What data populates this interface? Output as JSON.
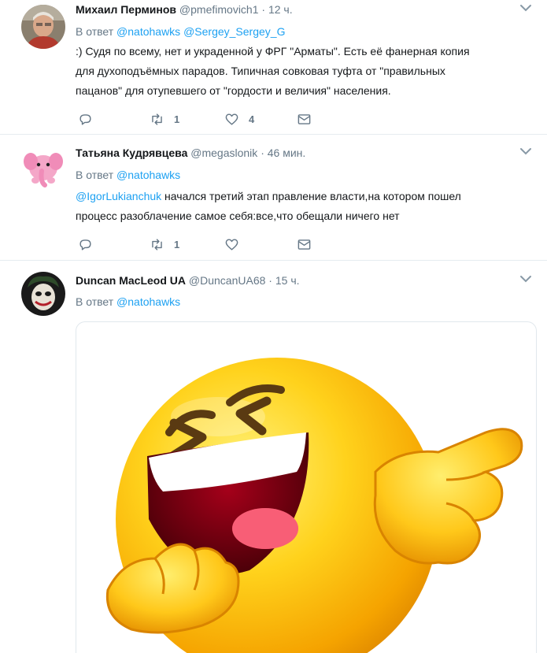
{
  "tweets": [
    {
      "name": "Михаил Перминов",
      "handle": "@pmefimovich1",
      "time": "12 ч.",
      "reply_prefix": "В ответ",
      "mentions": [
        "@natohawks",
        "@Sergey_Sergey_G"
      ],
      "text_lines": [
        ":) Судя по всему, нет и украденной у ФРГ \"Арматы\". Есть её фанерная копия",
        "для духоподъёмных парадов. Типичная совковая туфта от \"правильных",
        "пацанов\" для отупевшего от \"гордости и величия\" населения."
      ],
      "retweets": "1",
      "likes": "4"
    },
    {
      "name": "Татьяна Кудрявцева",
      "handle": "@megaslonik",
      "time": "46 мин.",
      "reply_prefix": "В ответ",
      "mentions": [
        "@natohawks"
      ],
      "text_mention": "@IgorLukianchuk",
      "text_lines": [
        " начался третий этап правление власти,на котором пошел",
        "процесс разоблачение самое себя:все,что обещали ничего нет"
      ],
      "retweets": "1",
      "likes": ""
    },
    {
      "name": "Duncan MacLeod UA",
      "handle": "@DuncanUA68",
      "time": "15 ч.",
      "reply_prefix": "В ответ",
      "mentions": [
        "@natohawks"
      ],
      "media": "laughing-pointing-emoji"
    }
  ],
  "separator": "·",
  "colors": {
    "link": "#1da1f2",
    "muted": "#657786",
    "text": "#14171a",
    "divider": "#e6ecf0"
  }
}
